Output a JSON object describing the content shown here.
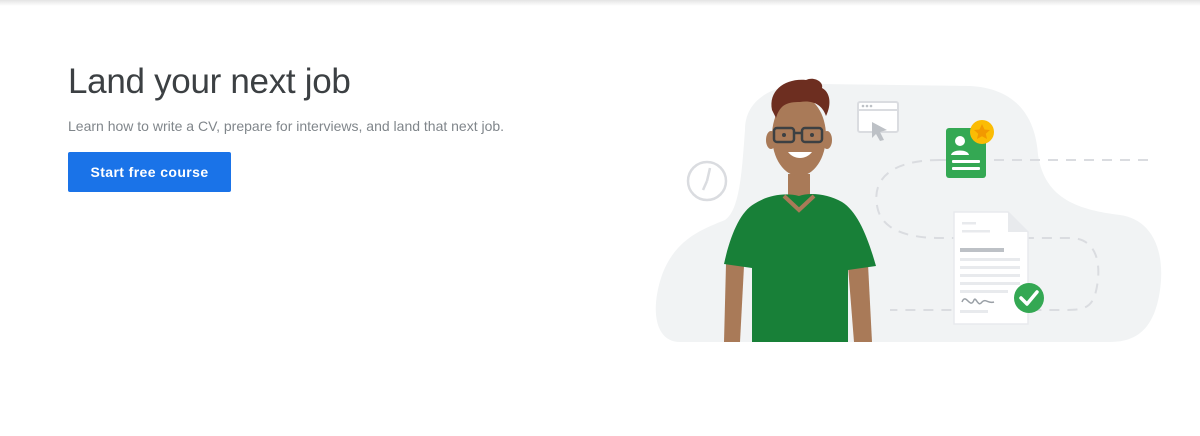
{
  "hero": {
    "title": "Land your next job",
    "subtitle": "Learn how to write a CV, prepare for interviews, and land that next job.",
    "cta_label": "Start free course"
  },
  "colors": {
    "accent": "#1a73e8",
    "shirt_green": "#188038",
    "card_green": "#34a853",
    "star_yellow": "#fbbc04",
    "blob_gray": "#f1f3f4"
  },
  "illustration": {
    "icons": [
      "clock-icon",
      "browser-cursor-icon",
      "profile-card-icon",
      "star-badge-icon",
      "document-icon",
      "checkmark-icon",
      "signature-icon"
    ]
  }
}
